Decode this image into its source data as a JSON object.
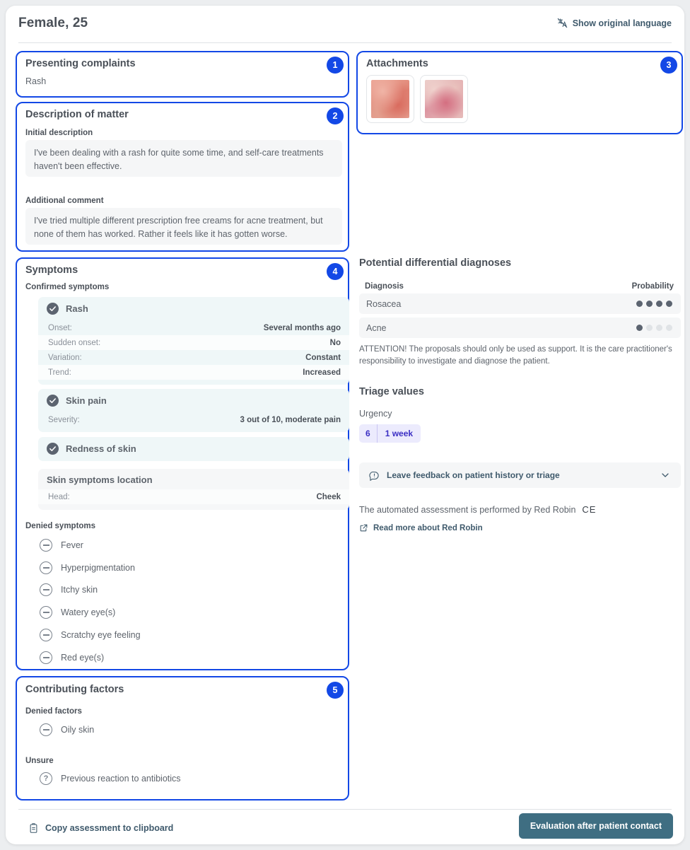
{
  "header": {
    "title": "Female, 25",
    "language_toggle": "Show original language",
    "language_icon": "translate-off-icon"
  },
  "presenting_complaints": {
    "badge": "1",
    "title": "Presenting complaints",
    "value": "Rash"
  },
  "description": {
    "badge": "2",
    "title": "Description of matter",
    "initial_label": "Initial description",
    "initial_text": "I've been dealing with a rash for quite some time, and self-care treatments haven't been effective.",
    "additional_label": "Additional comment",
    "additional_text": "I've tried multiple different prescription free creams for acne treatment, but none of them has worked. Rather it feels like it has gotten worse."
  },
  "attachments": {
    "badge": "3",
    "title": "Attachments",
    "items": [
      {
        "name": "rash-photo-1",
        "colors": [
          "#e9a79a",
          "#d9675c",
          "#e8b0a4"
        ]
      },
      {
        "name": "rash-photo-2",
        "colors": [
          "#e9c3c2",
          "#d4707f",
          "#e3b6b8"
        ]
      }
    ]
  },
  "symptoms": {
    "badge": "4",
    "title": "Symptoms",
    "confirmed_label": "Confirmed symptoms",
    "confirmed": [
      {
        "name": "Rash",
        "icon": "check-circle-icon",
        "details": [
          {
            "key": "Onset:",
            "value": "Several months ago"
          },
          {
            "key": "Sudden onset:",
            "value": "No"
          },
          {
            "key": "Variation:",
            "value": "Constant"
          },
          {
            "key": "Trend:",
            "value": "Increased"
          }
        ]
      },
      {
        "name": "Skin pain",
        "icon": "check-circle-icon",
        "details": [
          {
            "key": "Severity:",
            "value": "3 out of 10, moderate pain"
          }
        ]
      },
      {
        "name": "Redness of skin",
        "icon": "check-circle-icon",
        "details": []
      }
    ],
    "location": {
      "title": "Skin symptoms location",
      "details": [
        {
          "key": "Head:",
          "value": "Cheek"
        }
      ]
    },
    "denied_label": "Denied symptoms",
    "denied": [
      "Fever",
      "Hyperpigmentation",
      "Itchy skin",
      "Watery eye(s)",
      "Scratchy eye feeling",
      "Red eye(s)"
    ]
  },
  "contributing_factors": {
    "badge": "5",
    "title": "Contributing factors",
    "denied_label": "Denied factors",
    "denied": [
      "Oily skin"
    ],
    "unsure_label": "Unsure",
    "unsure": [
      "Previous reaction to antibiotics"
    ]
  },
  "diagnoses": {
    "title": "Potential differential diagnoses",
    "col_diagnosis": "Diagnosis",
    "col_probability": "Probability",
    "rows": [
      {
        "name": "Rosacea",
        "filled": 4,
        "total": 4
      },
      {
        "name": "Acne",
        "filled": 1,
        "total": 4
      }
    ],
    "attention": "ATTENTION! The proposals should only be used as support. It is the care practitioner's responsibility to investigate and diagnose the patient."
  },
  "triage": {
    "title": "Triage values",
    "urgency_label": "Urgency",
    "urgency_value": "6",
    "urgency_time": "1 week",
    "feedback_label": "Leave feedback on patient history or triage",
    "feedback_icon": "comment-alert-icon",
    "chevron_icon": "chevron-down-icon",
    "byline": "The automated assessment is performed by Red Robin",
    "ce_mark": "CE",
    "read_more": "Read more about Red Robin",
    "read_more_icon": "external-link-icon"
  },
  "footer": {
    "copy_label": "Copy assessment to clipboard",
    "copy_icon": "clipboard-icon",
    "eval_label": "Evaluation after patient contact"
  },
  "colors": {
    "accent_blue": "#1348e6",
    "button_teal": "#3f6e82",
    "urgency_bg": "#ecebfd",
    "urgency_text": "#3b2fc4"
  }
}
